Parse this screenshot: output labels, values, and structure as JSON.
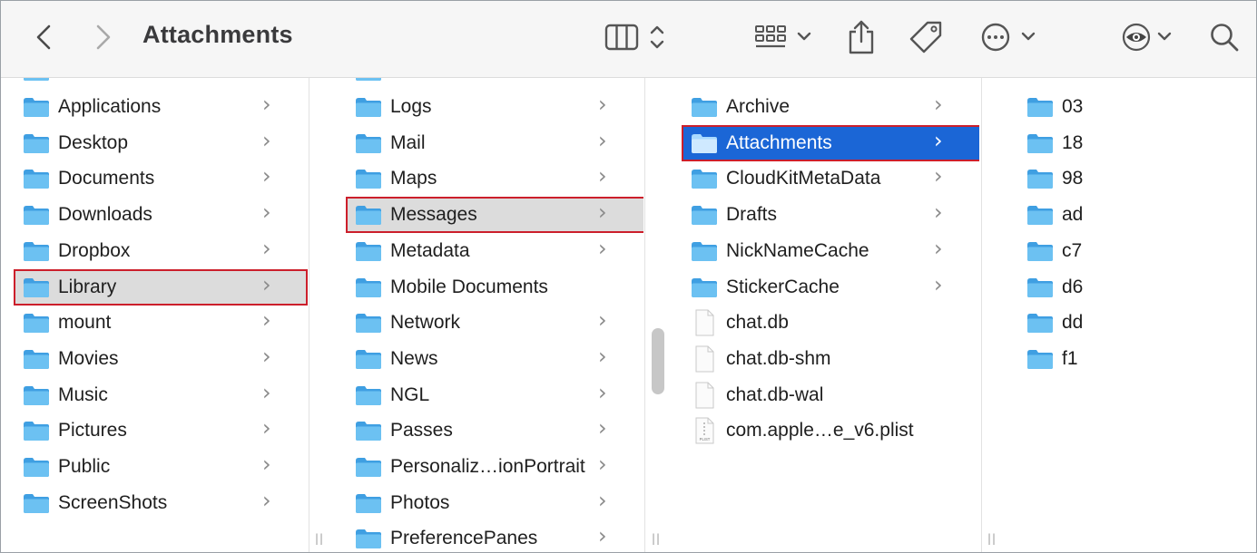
{
  "window": {
    "title": "Attachments"
  },
  "toolbar": {
    "back_icon": "chevron-left-icon",
    "forward_icon": "chevron-right-icon",
    "view_icon": "column-view-icon",
    "group_icon": "grid-icon",
    "share_icon": "share-icon",
    "tag_icon": "tag-icon",
    "more_icon": "ellipsis-circle-icon",
    "preview_icon": "eye-icon",
    "search_icon": "search-icon"
  },
  "columns": [
    {
      "items": [
        {
          "label": "Applications",
          "kind": "folder",
          "chevron": ">"
        },
        {
          "label": "Desktop",
          "kind": "folder",
          "chevron": ">"
        },
        {
          "label": "Documents",
          "kind": "folder",
          "chevron": ">"
        },
        {
          "label": "Downloads",
          "kind": "folder",
          "chevron": ">"
        },
        {
          "label": "Dropbox",
          "kind": "folder",
          "chevron": ">"
        },
        {
          "label": "Library",
          "kind": "folder",
          "chevron": ">",
          "selected": "gray"
        },
        {
          "label": "mount",
          "kind": "folder",
          "chevron": ">"
        },
        {
          "label": "Movies",
          "kind": "folder",
          "chevron": ">"
        },
        {
          "label": "Music",
          "kind": "folder",
          "chevron": ">"
        },
        {
          "label": "Pictures",
          "kind": "folder",
          "chevron": ">"
        },
        {
          "label": "Public",
          "kind": "folder",
          "chevron": ">"
        },
        {
          "label": "ScreenShots",
          "kind": "folder",
          "chevron": ">"
        }
      ]
    },
    {
      "items": [
        {
          "label": "Logs",
          "kind": "folder",
          "chevron": ">"
        },
        {
          "label": "Mail",
          "kind": "folder",
          "chevron": ">"
        },
        {
          "label": "Maps",
          "kind": "folder",
          "chevron": ">"
        },
        {
          "label": "Messages",
          "kind": "folder",
          "chevron": ">",
          "selected": "gray"
        },
        {
          "label": "Metadata",
          "kind": "folder",
          "chevron": ">"
        },
        {
          "label": "Mobile Documents",
          "kind": "folder",
          "chevron": ""
        },
        {
          "label": "Network",
          "kind": "folder",
          "chevron": ">"
        },
        {
          "label": "News",
          "kind": "folder",
          "chevron": ">"
        },
        {
          "label": "NGL",
          "kind": "folder",
          "chevron": ">"
        },
        {
          "label": "Passes",
          "kind": "folder",
          "chevron": ">"
        },
        {
          "label": "Personaliz…ionPortrait",
          "kind": "folder",
          "chevron": ">"
        },
        {
          "label": "Photos",
          "kind": "folder",
          "chevron": ">"
        },
        {
          "label": "PreferencePanes",
          "kind": "folder",
          "chevron": ">"
        }
      ]
    },
    {
      "items": [
        {
          "label": "Archive",
          "kind": "folder",
          "chevron": ">"
        },
        {
          "label": "Attachments",
          "kind": "folder",
          "chevron": ">",
          "selected": "blue"
        },
        {
          "label": "CloudKitMetaData",
          "kind": "folder",
          "chevron": ">"
        },
        {
          "label": "Drafts",
          "kind": "folder",
          "chevron": ">"
        },
        {
          "label": "NickNameCache",
          "kind": "folder",
          "chevron": ">"
        },
        {
          "label": "StickerCache",
          "kind": "folder",
          "chevron": ">"
        },
        {
          "label": "chat.db",
          "kind": "file",
          "chevron": ""
        },
        {
          "label": "chat.db-shm",
          "kind": "file",
          "chevron": ""
        },
        {
          "label": "chat.db-wal",
          "kind": "file",
          "chevron": ""
        },
        {
          "label": "com.apple…e_v6.plist",
          "kind": "plist",
          "chevron": ""
        }
      ]
    },
    {
      "items": [
        {
          "label": "03",
          "kind": "folder",
          "chevron": ""
        },
        {
          "label": "18",
          "kind": "folder",
          "chevron": ""
        },
        {
          "label": "98",
          "kind": "folder",
          "chevron": ""
        },
        {
          "label": "ad",
          "kind": "folder",
          "chevron": ""
        },
        {
          "label": "c7",
          "kind": "folder",
          "chevron": ""
        },
        {
          "label": "d6",
          "kind": "folder",
          "chevron": ""
        },
        {
          "label": "dd",
          "kind": "folder",
          "chevron": ""
        },
        {
          "label": "f1",
          "kind": "folder",
          "chevron": ""
        }
      ]
    }
  ],
  "plist_badge": "PLIST",
  "colors": {
    "selection_blue": "#1b66d6",
    "selection_gray": "#dcdcdc",
    "highlight_red": "#cc1f2b",
    "folder_blue": "#5fb4ea"
  }
}
